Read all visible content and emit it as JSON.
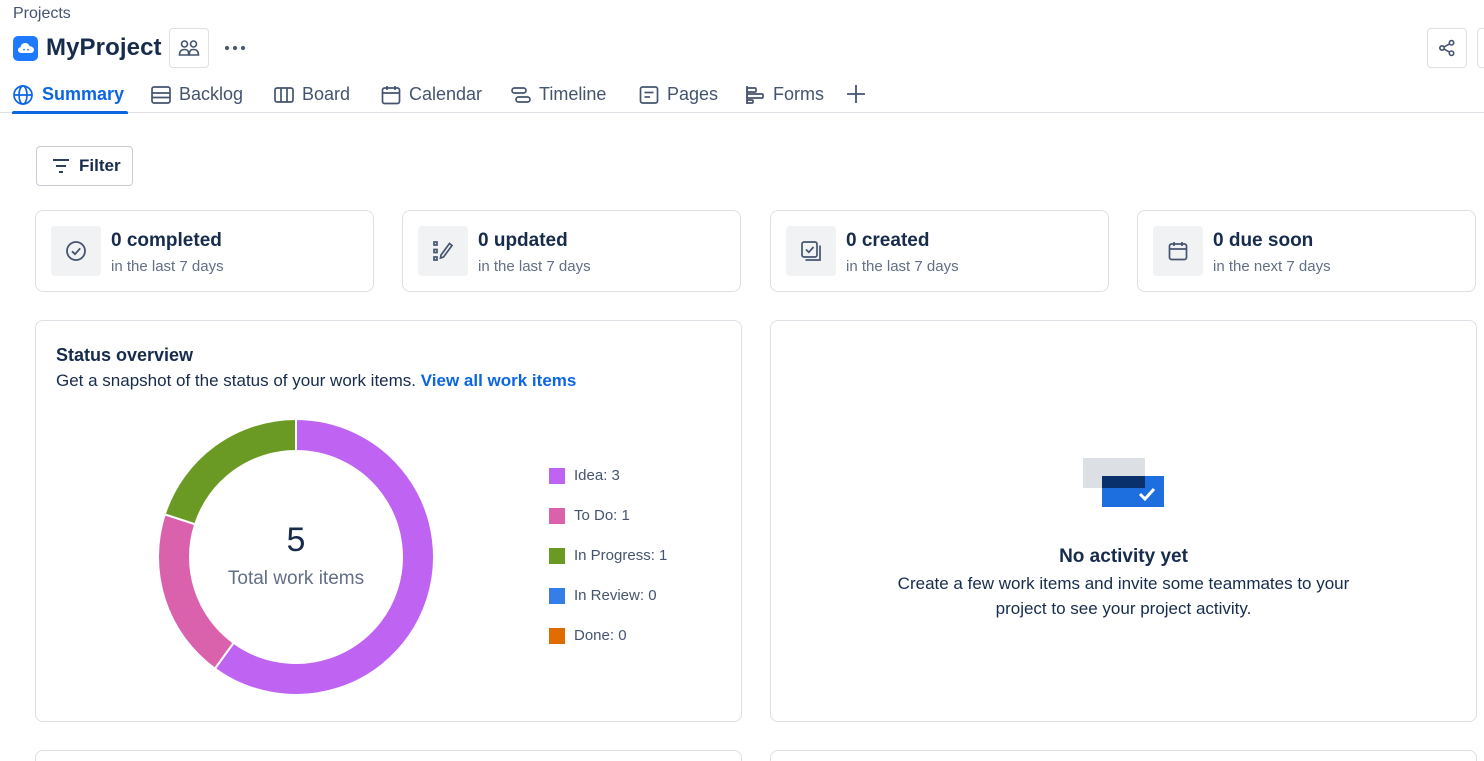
{
  "breadcrumb": "Projects",
  "project": {
    "title": "MyProject",
    "icon": "cloud-icon",
    "logo_color": "#1d7afc"
  },
  "header_actions": {
    "people_icon": "people-icon",
    "more_icon": "more-horizontal-icon",
    "share_icon": "share-icon"
  },
  "tabs": [
    {
      "label": "Summary",
      "icon": "globe-icon",
      "active": true
    },
    {
      "label": "Backlog",
      "icon": "backlog-icon"
    },
    {
      "label": "Board",
      "icon": "board-icon"
    },
    {
      "label": "Calendar",
      "icon": "calendar-icon"
    },
    {
      "label": "Timeline",
      "icon": "timeline-icon"
    },
    {
      "label": "Pages",
      "icon": "pages-icon"
    },
    {
      "label": "Forms",
      "icon": "forms-icon"
    }
  ],
  "add_tab_icon": "plus-icon",
  "filter": {
    "label": "Filter",
    "icon": "filter-icon"
  },
  "stats": [
    {
      "main": "0 completed",
      "sub": "in the last 7 days",
      "icon": "check-circle-icon"
    },
    {
      "main": "0 updated",
      "sub": "in the last 7 days",
      "icon": "edit-list-icon"
    },
    {
      "main": "0 created",
      "sub": "in the last 7 days",
      "icon": "create-icon"
    },
    {
      "main": "0 due soon",
      "sub": "in the next 7 days",
      "icon": "calendar-icon"
    }
  ],
  "status_overview": {
    "title": "Status overview",
    "description": "Get a snapshot of the status of your work items.",
    "link": "View all work items",
    "total": "5",
    "total_label": "Total work items",
    "legend": [
      {
        "label": "Idea: 3",
        "color": "#bf63f3"
      },
      {
        "label": "To Do: 1",
        "color": "#da62ac"
      },
      {
        "label": "In Progress: 1",
        "color": "#6a9a23"
      },
      {
        "label": "In Review: 0",
        "color": "#357de8"
      },
      {
        "label": "Done: 0",
        "color": "#e06c00"
      }
    ]
  },
  "chart_data": {
    "type": "pie",
    "categories": [
      "Idea",
      "To Do",
      "In Progress",
      "In Review",
      "Done"
    ],
    "values": [
      3,
      1,
      1,
      0,
      0
    ],
    "colors": [
      "#bf63f3",
      "#da62ac",
      "#6a9a23",
      "#357de8",
      "#e06c00"
    ],
    "title": "Status overview",
    "legend": "right",
    "donut": true
  },
  "activity": {
    "title": "No activity yet",
    "line1": "Create a few work items and invite some teammates to your",
    "line2": "project to see your project activity.",
    "illustration": "activity-illustration"
  }
}
